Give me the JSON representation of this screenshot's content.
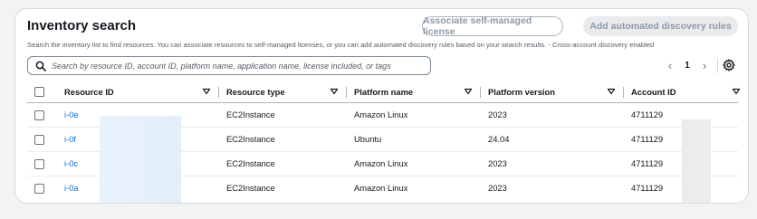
{
  "header": {
    "title": "Inventory search",
    "associate_button": "Associate self-managed license",
    "add_rules_button": "Add automated discovery rules",
    "description": "Search the inventory list to find resources. You can associate resources to self-managed licenses, or you can add automated discovery rules based on your search results. - Cross-account discovery enabled"
  },
  "search": {
    "placeholder": "Search by resource ID, account ID, platform name, application name, license included, or tags",
    "value": ""
  },
  "pagination": {
    "current_page": "1",
    "prev_icon": "chevron-left-icon",
    "next_icon": "chevron-right-icon"
  },
  "settings_icon": "gear-icon",
  "colors": {
    "link": "#0972d3",
    "border": "#d5dbdb",
    "disabled_text": "#8d99a8"
  },
  "table": {
    "columns": [
      "Resource ID",
      "Resource type",
      "Platform name",
      "Platform version",
      "Account ID"
    ],
    "rows": [
      {
        "resource_id": "i-0e",
        "resource_type": "EC2Instance",
        "platform_name": "Amazon Linux",
        "platform_version": "2023",
        "account_id": "4711129"
      },
      {
        "resource_id": "i-0f",
        "resource_type": "EC2Instance",
        "platform_name": "Ubuntu",
        "platform_version": "24.04",
        "account_id": "4711129"
      },
      {
        "resource_id": "i-0c",
        "resource_type": "EC2Instance",
        "platform_name": "Amazon Linux",
        "platform_version": "2023",
        "account_id": "4711129"
      },
      {
        "resource_id": "i-0a",
        "resource_type": "EC2Instance",
        "platform_name": "Amazon Linux",
        "platform_version": "2023",
        "account_id": "4711129"
      }
    ]
  }
}
